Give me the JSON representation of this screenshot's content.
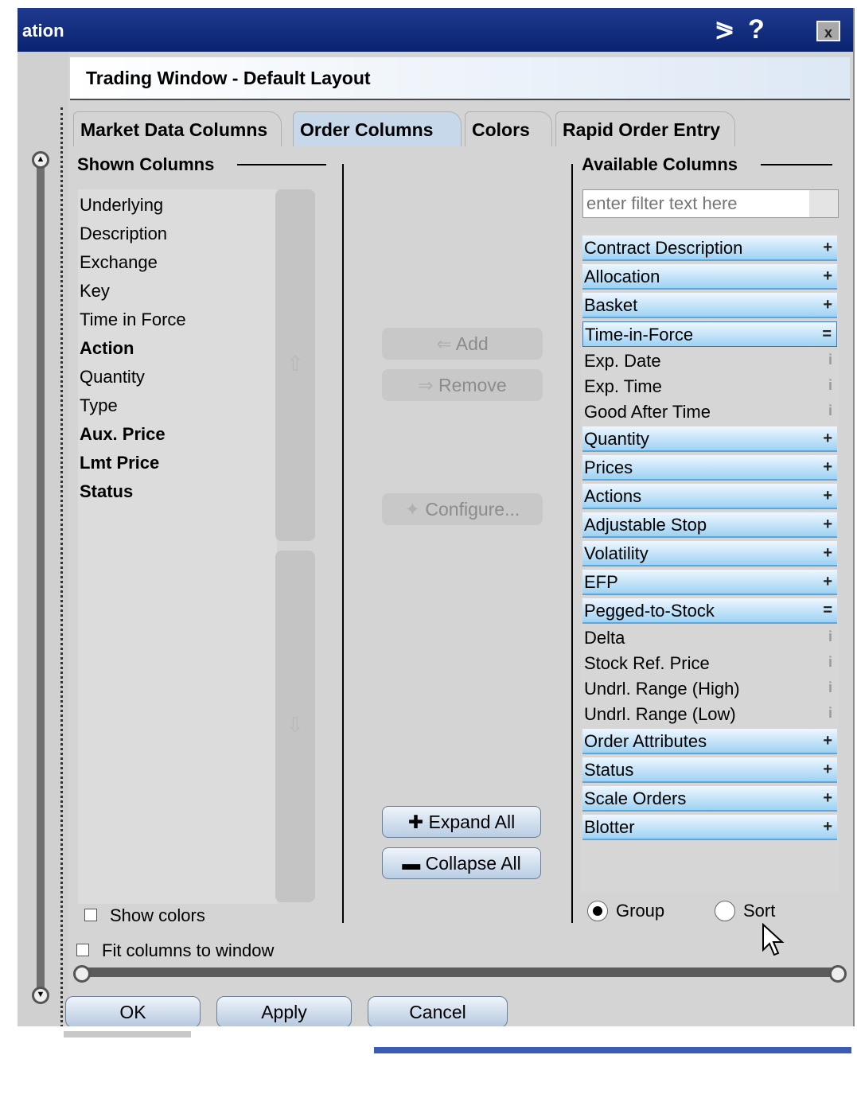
{
  "window": {
    "title": "ation",
    "pin_icon": "pin-icon",
    "help_icon": "?",
    "close_icon": "x"
  },
  "header": {
    "title": "Trading Window - Default Layout"
  },
  "tabs": [
    {
      "label": "Market Data Columns",
      "active": false
    },
    {
      "label": "Order Columns",
      "active": true
    },
    {
      "label": "Colors",
      "active": false
    },
    {
      "label": "Rapid Order Entry",
      "active": false
    }
  ],
  "shown": {
    "label": "Shown Columns",
    "items": [
      {
        "label": "Underlying",
        "bold": false
      },
      {
        "label": "Description",
        "bold": false
      },
      {
        "label": "Exchange",
        "bold": false
      },
      {
        "label": "Key",
        "bold": false
      },
      {
        "label": "Time in Force",
        "bold": false
      },
      {
        "label": "Action",
        "bold": true
      },
      {
        "label": "Quantity",
        "bold": false
      },
      {
        "label": "Type",
        "bold": false
      },
      {
        "label": "Aux. Price",
        "bold": true
      },
      {
        "label": "Lmt Price",
        "bold": true
      },
      {
        "label": "Status",
        "bold": true
      }
    ],
    "show_colors_label": "Show colors"
  },
  "middle": {
    "add_label": "Add",
    "remove_label": "Remove",
    "configure_label": "Configure...",
    "expand_all_label": "Expand All",
    "collapse_all_label": "Collapse All"
  },
  "available": {
    "label": "Available Columns",
    "filter_placeholder": "enter filter text here",
    "items": [
      {
        "label": "Contract Description",
        "kind": "group",
        "icon": "+"
      },
      {
        "label": "Allocation",
        "kind": "group",
        "icon": "+"
      },
      {
        "label": "Basket",
        "kind": "group",
        "icon": "+"
      },
      {
        "label": "Time-in-Force",
        "kind": "group-selected",
        "icon": "="
      },
      {
        "label": "Exp. Date",
        "kind": "sub",
        "icon": "i"
      },
      {
        "label": "Exp. Time",
        "kind": "sub",
        "icon": "i"
      },
      {
        "label": "Good After Time",
        "kind": "sub",
        "icon": "i"
      },
      {
        "label": "Quantity",
        "kind": "group",
        "icon": "+"
      },
      {
        "label": "Prices",
        "kind": "group",
        "icon": "+"
      },
      {
        "label": "Actions",
        "kind": "group",
        "icon": "+"
      },
      {
        "label": "Adjustable Stop",
        "kind": "group",
        "icon": "+"
      },
      {
        "label": "Volatility",
        "kind": "group",
        "icon": "+"
      },
      {
        "label": "EFP",
        "kind": "group",
        "icon": "+"
      },
      {
        "label": "Pegged-to-Stock",
        "kind": "group",
        "icon": "="
      },
      {
        "label": "Delta",
        "kind": "sub",
        "icon": "i"
      },
      {
        "label": "Stock Ref. Price",
        "kind": "sub",
        "icon": "i"
      },
      {
        "label": "Undrl. Range (High)",
        "kind": "sub",
        "icon": "i"
      },
      {
        "label": "Undrl. Range (Low)",
        "kind": "sub",
        "icon": "i"
      },
      {
        "label": "Order Attributes",
        "kind": "group",
        "icon": "+"
      },
      {
        "label": "Status",
        "kind": "group",
        "icon": "+"
      },
      {
        "label": "Scale Orders",
        "kind": "group",
        "icon": "+"
      },
      {
        "label": "Blotter",
        "kind": "group",
        "icon": "+"
      }
    ],
    "group_label": "Group",
    "sort_label": "Sort",
    "selected_mode": "Group"
  },
  "fit_columns_label": "Fit columns to window",
  "footer": {
    "ok_label": "OK",
    "apply_label": "Apply",
    "cancel_label": "Cancel"
  },
  "colors": {
    "title_bar": "#0a2370",
    "group_row": "#9ed2f2",
    "active_tab": "#c6d8ea",
    "panel": "#d4d4d4"
  }
}
